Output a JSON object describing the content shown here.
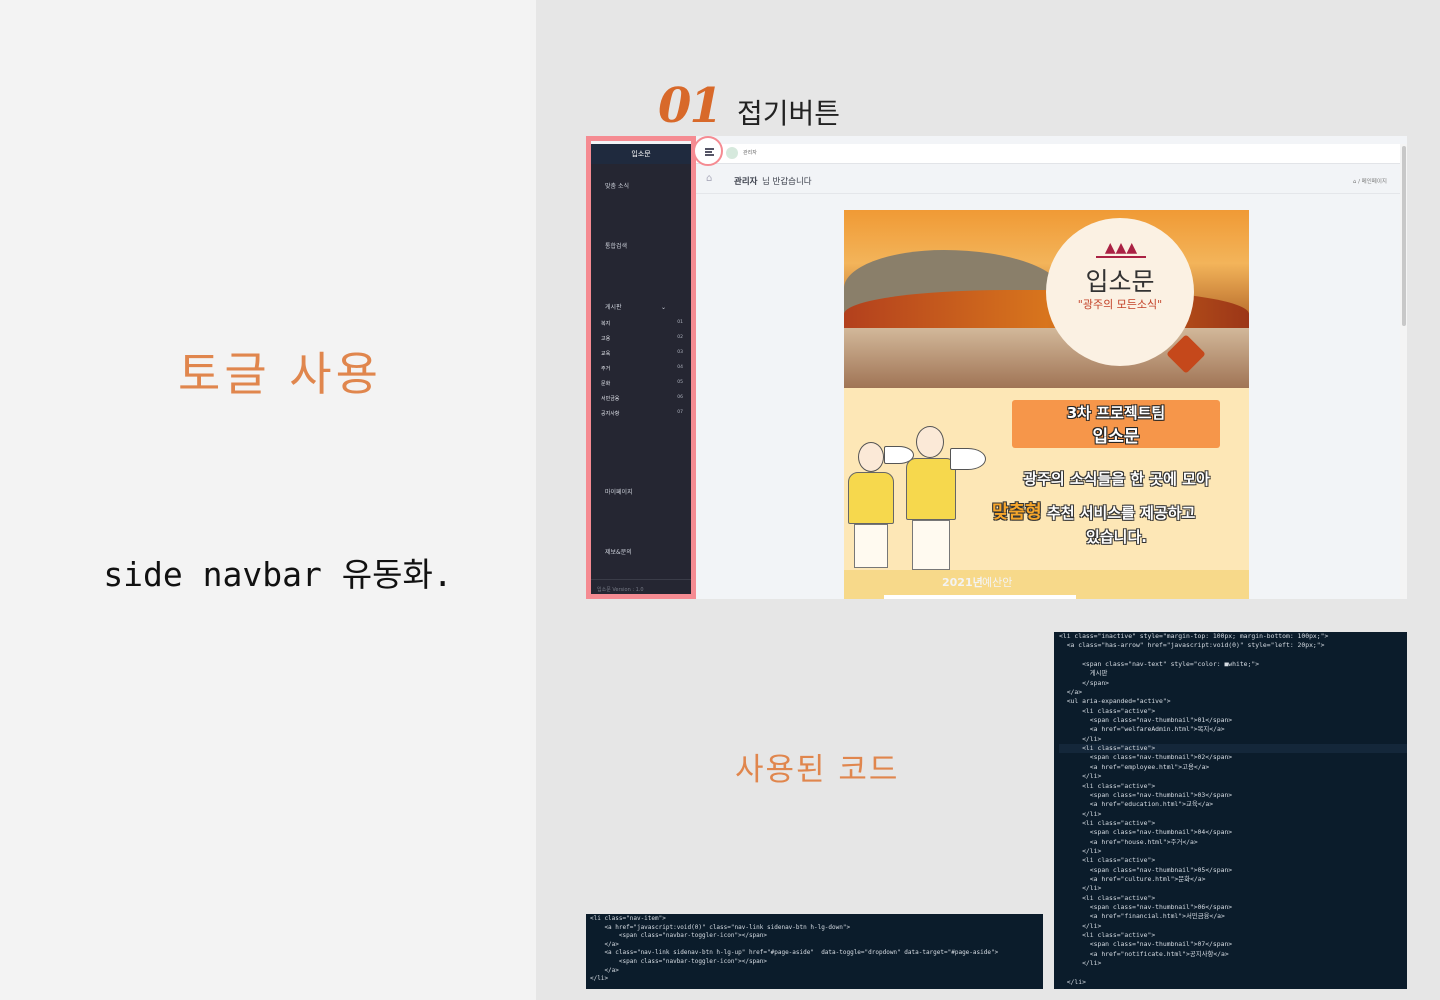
{
  "left": {
    "heading": "토글 사용",
    "description": "side navbar 유동화."
  },
  "step": {
    "number": "01",
    "title": "접기버튼"
  },
  "code_section_title": "사용된 코드",
  "screenshot": {
    "sidebar": {
      "brand": "입소문",
      "menu": [
        {
          "label": "맞춤 소식"
        },
        {
          "label": "통합검색"
        },
        {
          "label": "게시판"
        },
        {
          "label": "마이페이지"
        },
        {
          "label": "제보&문의"
        }
      ],
      "caret": "⌄",
      "submenu": [
        {
          "label": "복지",
          "num": "01"
        },
        {
          "label": "고용",
          "num": "02"
        },
        {
          "label": "교육",
          "num": "03"
        },
        {
          "label": "주거",
          "num": "04"
        },
        {
          "label": "문화",
          "num": "05"
        },
        {
          "label": "서민금융",
          "num": "06"
        },
        {
          "label": "공지사항",
          "num": "07"
        }
      ],
      "footer": "입소문 Version : 1.0"
    },
    "topbar": {
      "admin_label": "관리자"
    },
    "greeting": {
      "name": "관리자",
      "rest": "님 반갑습니다",
      "breadcrumb": "⌂ / 메인페이지"
    },
    "poster": {
      "logo_title": "입소문",
      "logo_subtitle": "\"광주의 모든소식\"",
      "team_line1": "3차 프로젝트팀",
      "team_line2": "입소문",
      "slogan_line1": "광주의 소식들을 한 곳에 모아",
      "slogan_highlight": "맞춤형",
      "slogan_line2_rest": " 추천 서비스를 제공하고",
      "slogan_line3": "있습니다.",
      "year": "2021년",
      "year_rest": "예산안"
    }
  },
  "code_right": [
    "<li class=\"inactive\" style=\"margin-top: 100px; margin-bottom: 100px;\">",
    "  <a class=\"has-arrow\" href=\"javascript:void(0)\" style=\"left: 20px;\">",
    "",
    "      <span class=\"nav-text\" style=\"color: ■white;\">",
    "        게시판",
    "      </span>",
    "  </a>",
    "  <ul aria-expanded=\"active\">",
    "      <li class=\"active\">",
    "        <span class=\"nav-thumbnail\">01</span>",
    "        <a href=\"welfareAdmin.html\">복지</a>",
    "      </li>",
    "      <li class=\"active\">",
    "        <span class=\"nav-thumbnail\">02</span>",
    "        <a href=\"employee.html\">고용</a>",
    "      </li>",
    "      <li class=\"active\">",
    "        <span class=\"nav-thumbnail\">03</span>",
    "        <a href=\"education.html\">교육</a>",
    "      </li>",
    "      <li class=\"active\">",
    "        <span class=\"nav-thumbnail\">04</span>",
    "        <a href=\"house.html\">주거</a>",
    "      </li>",
    "      <li class=\"active\">",
    "        <span class=\"nav-thumbnail\">05</span>",
    "        <a href=\"culture.html\">문화</a>",
    "      </li>",
    "      <li class=\"active\">",
    "        <span class=\"nav-thumbnail\">06</span>",
    "        <a href=\"financial.html\">서민금융</a>",
    "      </li>",
    "      <li class=\"active\">",
    "        <span class=\"nav-thumbnail\">07</span>",
    "        <a href=\"notificate.html\">공지사항</a>",
    "      </li>",
    "",
    "  </li>"
  ],
  "code_bottom": [
    "<li class=\"nav-item\">",
    "    <a href=\"javascript:void(0)\" class=\"nav-link sidenav-btn h-lg-down\">",
    "        <span class=\"navbar-toggler-icon\"></span>",
    "    </a>",
    "    <a class=\"nav-link sidenav-btn h-lg-up\" href=\"#page-aside\"  data-toggle=\"dropdown\" data-target=\"#page-aside\">",
    "        <span class=\"navbar-toggler-icon\"></span>",
    "    </a>",
    "</li>"
  ],
  "colors": {
    "accent_orange": "#e0864d",
    "highlight_pink": "#f58b92",
    "sidebar_dark": "#252632",
    "code_bg": "#0b1c2b"
  }
}
